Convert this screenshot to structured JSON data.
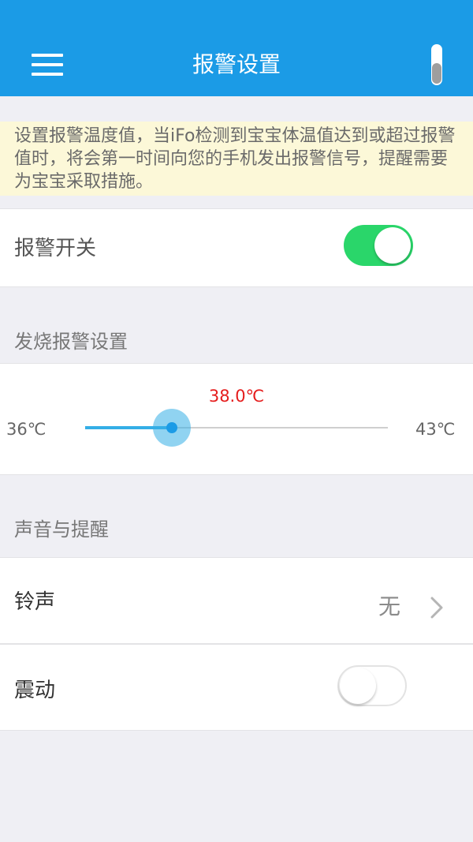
{
  "header": {
    "title": "报警设置",
    "menu_icon": "menu-icon",
    "bg_color": "#1b9be6"
  },
  "info_banner": {
    "text": "设置报警温度值，当iFo检测到宝宝体温值达到或超过报警值时，将会第一时间向您的手机发出报警信号，提醒需要为宝宝采取措施。"
  },
  "alarm_switch": {
    "label": "报警开关",
    "on": true,
    "accent": "#2ad66a"
  },
  "fever_section": {
    "title": "发烧报警设置",
    "slider": {
      "value_label": "38.0℃",
      "min_label": "36℃",
      "max_label": "43℃",
      "min": 36,
      "max": 43,
      "value": 38.0,
      "value_color": "#e51c1c"
    }
  },
  "sound_section": {
    "title": "声音与提醒",
    "ringtone": {
      "label": "铃声",
      "value": "无",
      "icon": "chevron-right-icon"
    },
    "vibrate": {
      "label": "震动",
      "on": false
    }
  }
}
